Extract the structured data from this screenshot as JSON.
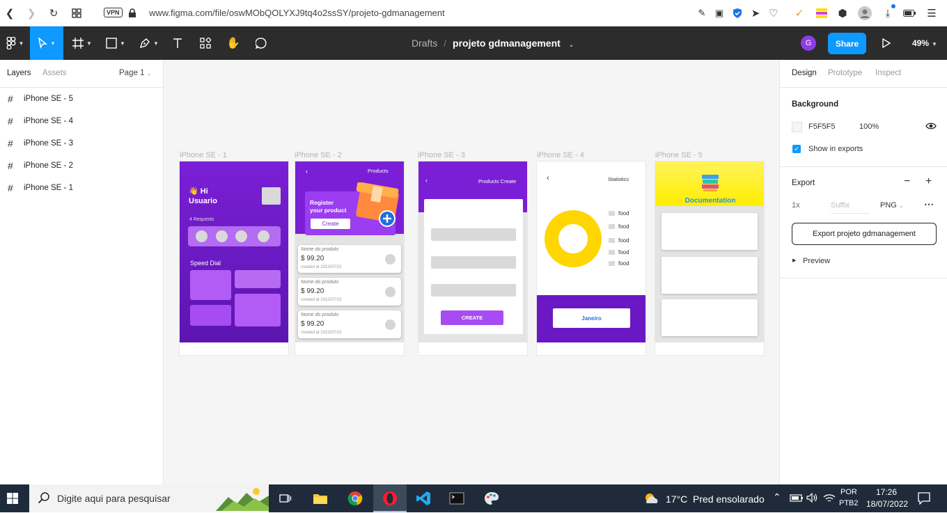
{
  "browser": {
    "url": "www.figma.com/file/oswMObQOLYXJ9tq4o2ssSY/projeto-gdmanagement",
    "vpn_label": "VPN"
  },
  "toolbar": {
    "breadcrumb_parent": "Drafts",
    "breadcrumb_sep": "/",
    "project_name": "projeto gdmanagement",
    "avatar_letter": "G",
    "share_label": "Share",
    "zoom": "49%"
  },
  "left_panel": {
    "tabs": [
      "Layers",
      "Assets"
    ],
    "page_select": "Page 1",
    "layers": [
      "iPhone SE - 5",
      "iPhone SE - 4",
      "iPhone SE - 3",
      "iPhone SE - 2",
      "iPhone SE - 1"
    ]
  },
  "canvas": {
    "frame_labels": [
      "iPhone SE - 1",
      "iPhone SE - 2",
      "iPhone SE - 3",
      "iPhone SE - 4",
      "iPhone SE - 5"
    ],
    "frame1": {
      "greeting": "👋 Hi",
      "user": "Usuario",
      "requests": "4 Requests",
      "speed_dial": "Speed Dial"
    },
    "frame2": {
      "title": "Products",
      "banner_line1": "Register",
      "banner_line2": "your product",
      "create_btn": "Create",
      "cards": [
        {
          "name": "Nome do produto",
          "price": "$ 99.20",
          "date": "created at 2022/07/13"
        },
        {
          "name": "Nome do produto",
          "price": "$ 99.20",
          "date": "created at 2022/07/13"
        },
        {
          "name": "Nome do produto",
          "price": "$ 99.20",
          "date": "created at 2022/07/13"
        }
      ]
    },
    "frame3": {
      "title": "Products Create",
      "create_btn": "CREATE"
    },
    "frame4": {
      "title": "Statistics",
      "legend": [
        "food",
        "food",
        "food",
        "food",
        "food"
      ],
      "month_btn": "Janeiro"
    },
    "frame5": {
      "title": "Documentation"
    }
  },
  "right_panel": {
    "tabs": [
      "Design",
      "Prototype",
      "Inspect"
    ],
    "background_label": "Background",
    "bg_hex": "F5F5F5",
    "bg_opacity": "100%",
    "show_in_exports": "Show in exports",
    "export_label": "Export",
    "export_scale": "1x",
    "suffix_placeholder": "Suffix",
    "format": "PNG",
    "export_button": "Export projeto gdmanagement",
    "preview_label": "Preview"
  },
  "help_label": "?",
  "taskbar": {
    "search_placeholder": "Digite aqui para pesquisar",
    "weather_temp": "17°C",
    "weather_desc": "Pred ensolarado",
    "lang_line1": "POR",
    "lang_line2": "PTB2",
    "time": "17:26",
    "date": "18/07/2022"
  },
  "colors": {
    "accent": "#0d99ff",
    "purple": "#7a1fd6",
    "purple_dark": "#5a14a8",
    "yellow": "#ffd600",
    "toolbar_bg": "#2c2c2c",
    "canvas_bg": "#f5f5f5"
  }
}
